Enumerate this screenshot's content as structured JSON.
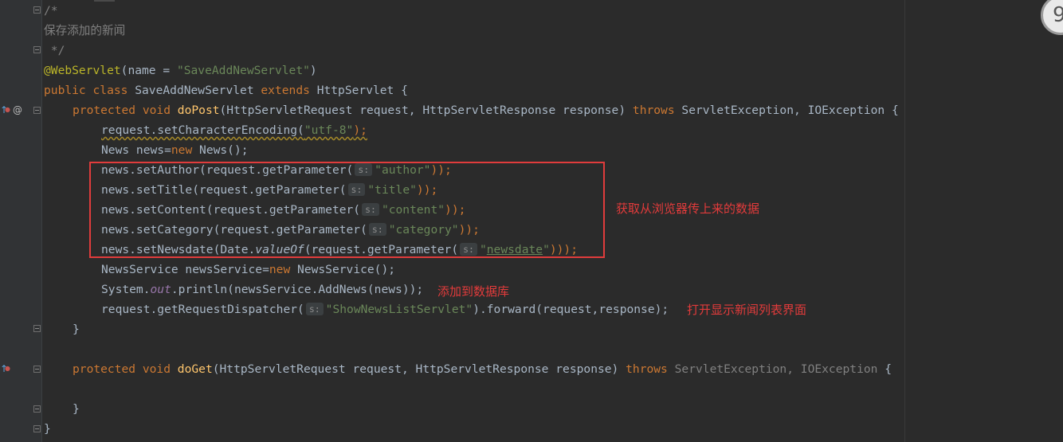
{
  "editor": {
    "comment_open": "/*",
    "comment_text": "保存添加的新闻",
    "comment_close": " */",
    "annotation": "@WebServlet",
    "annotation_args_open": "(name = ",
    "annotation_value": "\"SaveAddNewServlet\"",
    "annotation_args_close": ")",
    "class_kw": "public class ",
    "class_name": "SaveAddNewServlet ",
    "extends_kw": "extends ",
    "class_rest": "HttpServlet {",
    "dopost_kw": "protected void ",
    "dopost_name": "doPost",
    "dopost_params": "(HttpServletRequest request, HttpServletResponse response) ",
    "throws_kw": "throws ",
    "dopost_exc": "ServletException, IOException {",
    "line_encoding_a": "request.setCharacterEncoding(",
    "line_encoding_str": "\"utf-8\"",
    "line_encoding_b": ");",
    "line_news_a": "News news=",
    "new_kw": "new ",
    "line_news_b": "News();",
    "set_author": "news.setAuthor(request.getParameter(",
    "set_title": "news.setTitle(request.getParameter(",
    "set_content": "news.setContent(request.getParameter(",
    "set_category": "news.setCategory(request.getParameter(",
    "set_newsdate_a": "news.setNewsdate(Date.",
    "value_of": "valueOf",
    "set_newsdate_b": "(request.getParameter(",
    "param_hint": "s:",
    "str_author": "\"author\"",
    "str_title": "\"title\"",
    "str_content": "\"content\"",
    "str_category": "\"category\"",
    "str_newsdate_q1": "\"",
    "str_newsdate_word": "newsdate",
    "str_newsdate_q2": "\"",
    "close_two": "));",
    "close_three": ")));",
    "service_a": "NewsService newsService=",
    "service_b": "NewsService();",
    "println_a": "System.",
    "println_out": "out",
    "println_b": ".println(newsService.AddNews(news));",
    "dispatch_a": "request.getRequestDispatcher(",
    "dispatch_str": "\"ShowNewsListServlet\"",
    "dispatch_b": ").forward(request,response);",
    "brace_close": "}",
    "doget_name": "doGet",
    "doget_params": "(HttpServletRequest request, HttpServletResponse response) ",
    "doget_exc_dim": "ServletException, IOException ",
    "doget_brace": "{"
  },
  "annotations": {
    "box_label": "获取从浏览器传上来的数据",
    "add_label": "添加到数据库",
    "open_label": "打开显示新闻列表界面"
  },
  "gutter": {
    "override_icon": "override-icon",
    "at_icon": "@"
  },
  "badge": {
    "text": "9"
  }
}
